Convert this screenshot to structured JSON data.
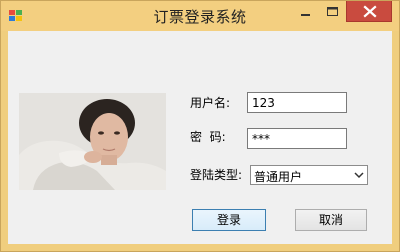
{
  "window": {
    "title": "订票登录系统",
    "icons": {
      "app": "app-icon",
      "minimize": "minimize-icon",
      "maximize": "maximize-icon",
      "close": "close-icon"
    },
    "colors": {
      "titlebar": "#f3cf80",
      "close_button": "#c94b3f",
      "client": "#f0f0f0"
    }
  },
  "form": {
    "username_label": "用户名:",
    "username_value": "123",
    "password_label": "密  码:",
    "password_display": "***",
    "login_type_label": "登陆类型:",
    "login_type_selected": "普通用户"
  },
  "buttons": {
    "login": "登录",
    "cancel": "取消"
  },
  "photo": {
    "icon": "profile-photo"
  }
}
